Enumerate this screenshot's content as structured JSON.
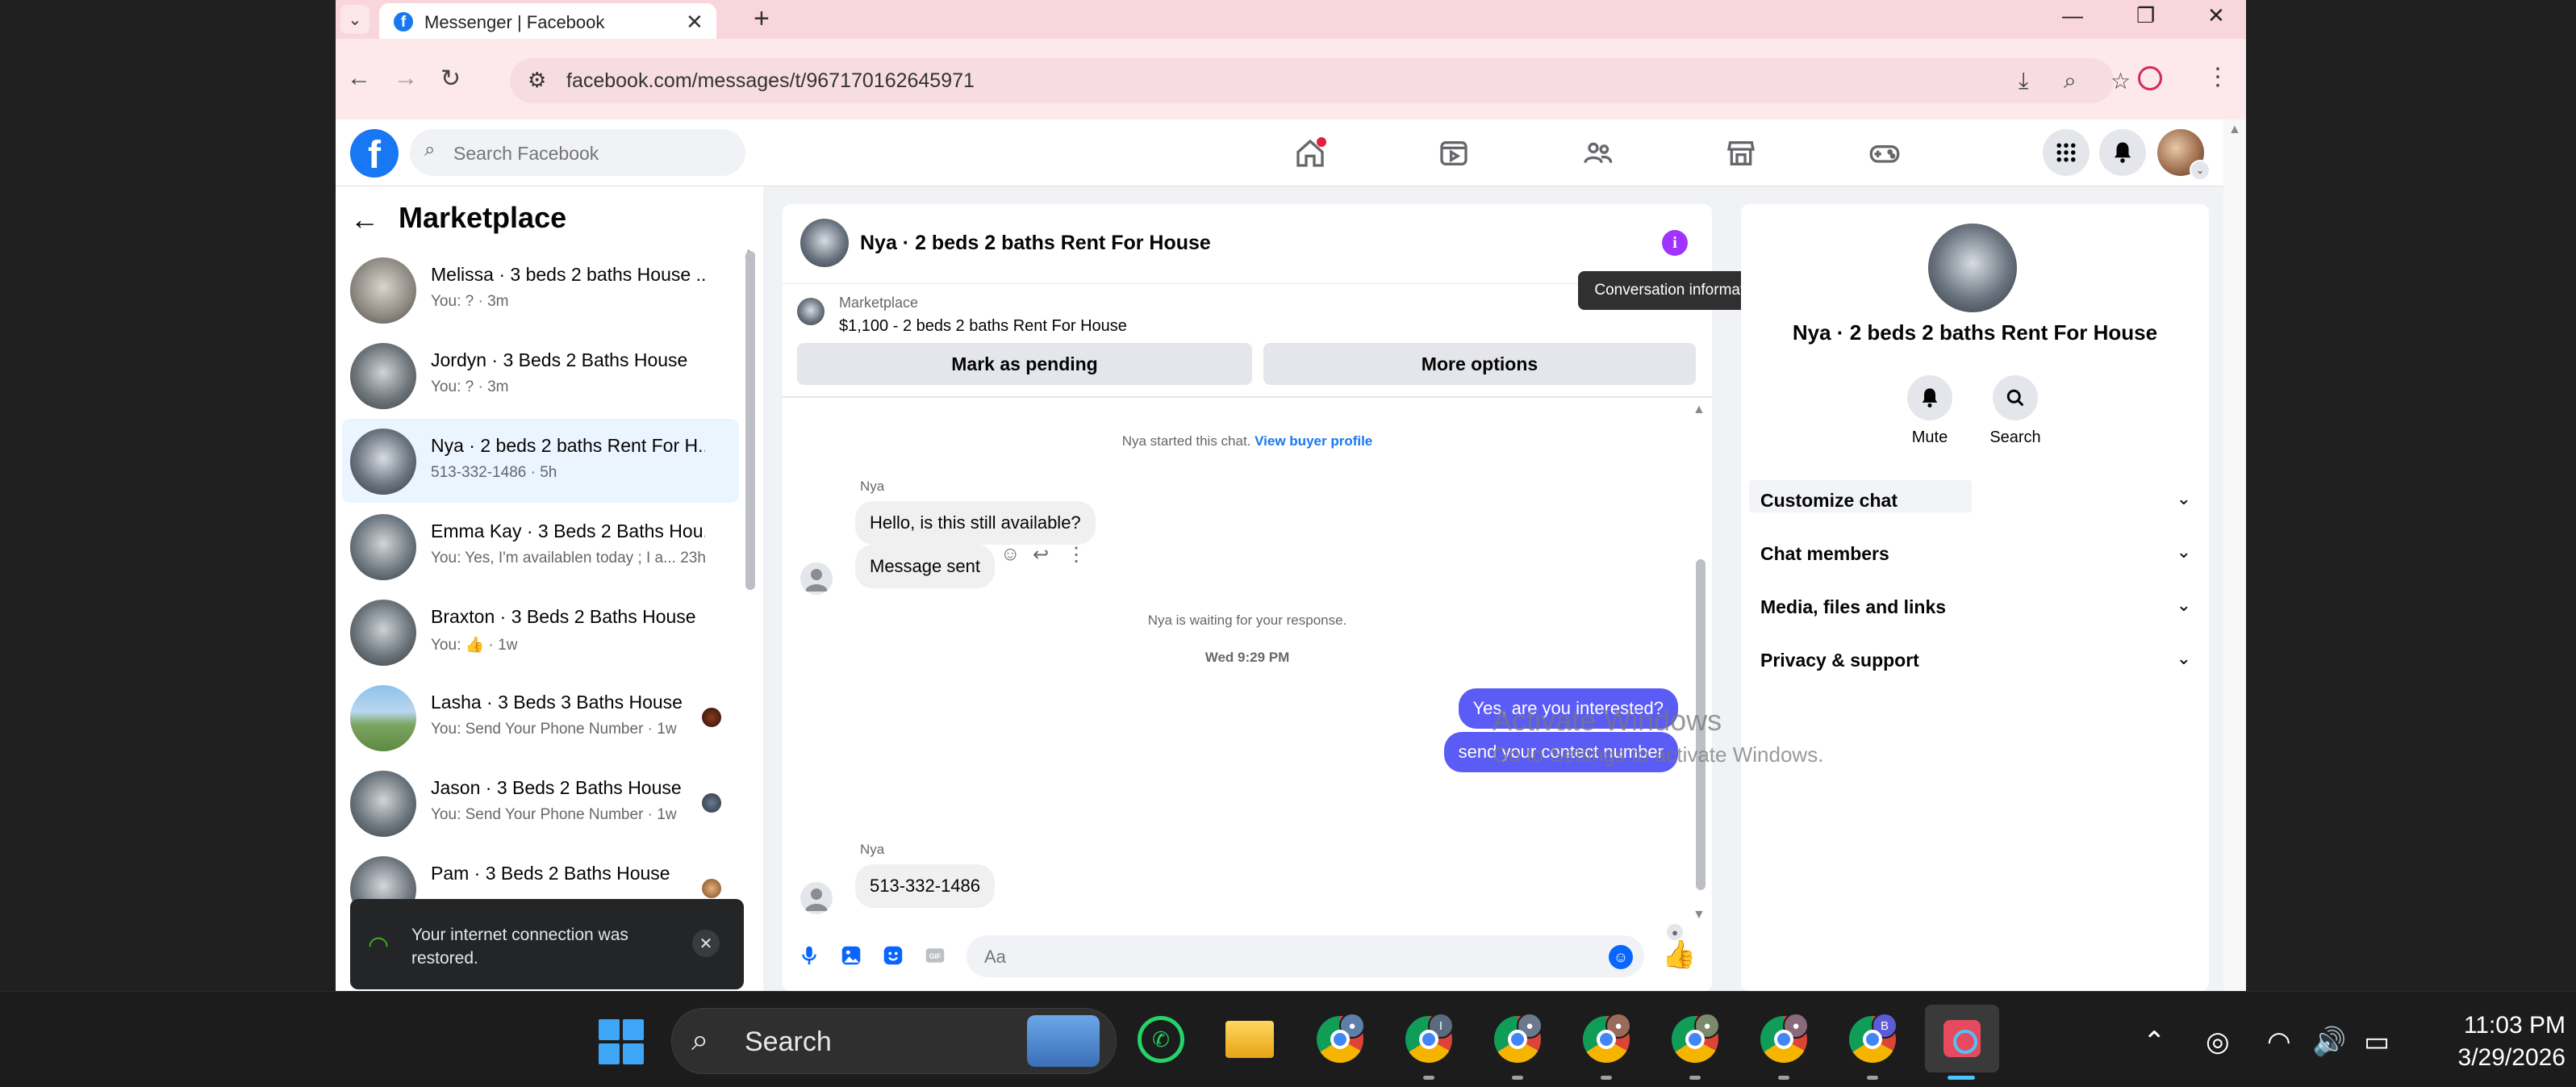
{
  "browser": {
    "tab_title": "Messenger | Facebook",
    "url": "facebook.com/messages/t/967170162645971"
  },
  "facebook": {
    "search_placeholder": "Search Facebook"
  },
  "left_panel": {
    "title": "Marketplace",
    "conversations": [
      {
        "name": "Melissa · 3 beds 2 baths House ...",
        "sub": "You: ? · 3m"
      },
      {
        "name": "Jordyn · 3 Beds 2 Baths House",
        "sub": "You: ? · 3m"
      },
      {
        "name": "Nya · 2 beds 2 baths Rent For H...",
        "sub": "513-332-1486 · 5h"
      },
      {
        "name": "Emma Kay · 3 Beds 2 Baths Hou...",
        "sub": "You: Yes, I'm availablen today ; I a... 23h"
      },
      {
        "name": "Braxton · 3 Beds 2 Baths House",
        "sub": "You: 👍 · 1w"
      },
      {
        "name": "Lasha · 3 Beds 3 Baths House",
        "sub": "You: Send Your Phone Number · 1w"
      },
      {
        "name": "Jason · 3 Beds 2 Baths House",
        "sub": "You: Send Your Phone Number · 1w"
      },
      {
        "name": "Pam · 3 Beds 2 Baths House",
        "sub": ""
      }
    ]
  },
  "toast": {
    "text": "Your internet connection was restored."
  },
  "chat": {
    "title": "Nya · 2 beds 2 baths Rent For House",
    "marketplace_label": "Marketplace",
    "listing": "$1,100 - 2 beds 2 baths Rent For House",
    "mark_pending": "Mark as pending",
    "more_options": "More options",
    "started": "Nya started this chat.",
    "view_profile": "View buyer profile",
    "sender1": "Nya",
    "msg1": "Hello, is this still available?",
    "msg2": "Message sent",
    "waiting": "Nya is waiting for your response.",
    "timestamp": "Wed 9:29 PM",
    "out1": "Yes, are you interested?",
    "out2": "send your contect number",
    "sender2": "Nya",
    "msg3": "513-332-1486",
    "composer_placeholder": "Aa"
  },
  "tooltip": "Conversation information",
  "info_panel": {
    "title": "Nya · 2 beds 2 baths Rent For House",
    "mute": "Mute",
    "search": "Search",
    "sections": [
      "Customize chat",
      "Chat members",
      "Media, files and links",
      "Privacy & support"
    ]
  },
  "watermark": {
    "line1": "Activate Windows",
    "line2": "Go to Settings to activate Windows."
  },
  "taskbar": {
    "search_label": "Search",
    "time": "11:03 PM",
    "date": "3/29/2026"
  }
}
